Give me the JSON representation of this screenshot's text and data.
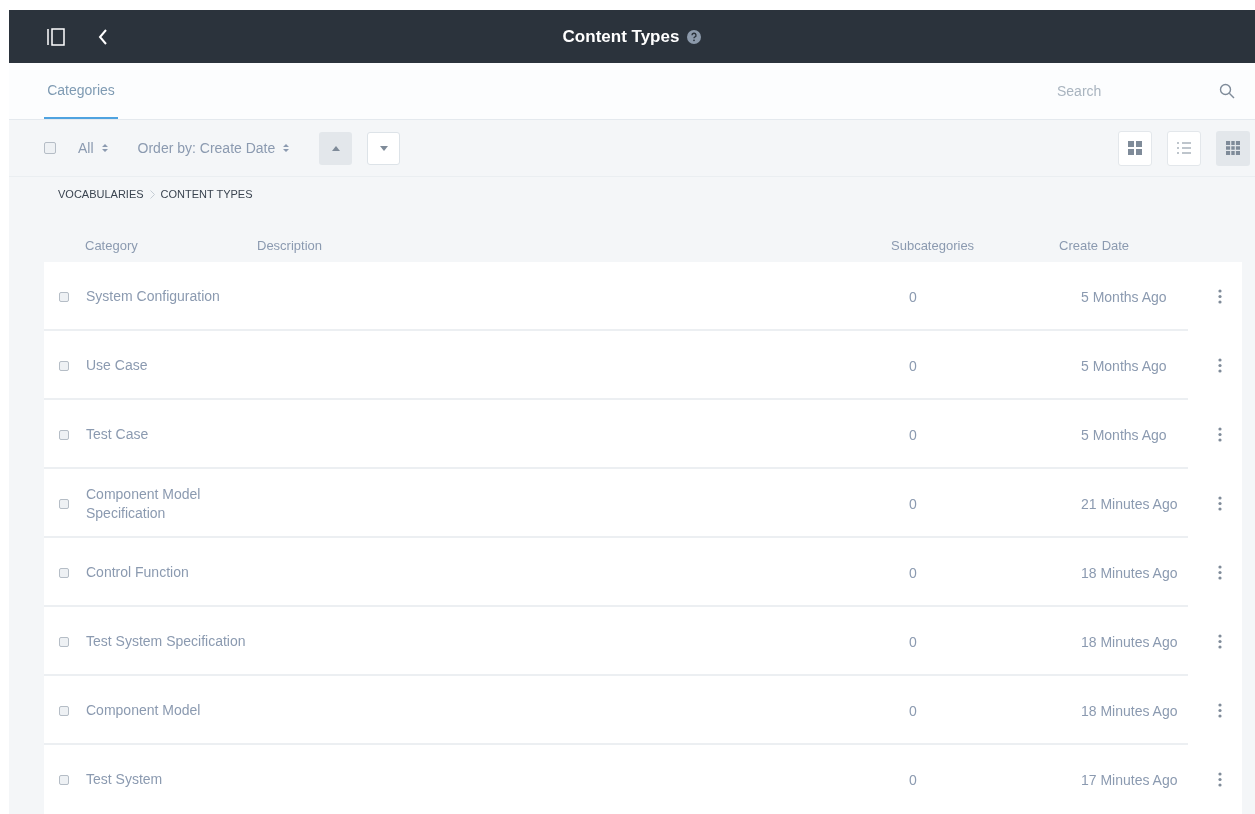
{
  "header": {
    "title": "Content Types"
  },
  "tabs": [
    {
      "label": "Categories",
      "selected": true
    }
  ],
  "search": {
    "placeholder": "Search"
  },
  "toolbar": {
    "select_all": {
      "label": "All",
      "checked": false
    },
    "order_by": "Order by: Create Date",
    "sort": [
      {
        "kind": "up",
        "selected": true
      },
      {
        "kind": "down",
        "selected": false
      }
    ],
    "views": [
      {
        "kind": "cards",
        "selected": false
      },
      {
        "kind": "list",
        "selected": false
      },
      {
        "kind": "table",
        "selected": true
      }
    ]
  },
  "breadcrumb": [
    "VOCABULARIES",
    "CONTENT TYPES"
  ],
  "table": {
    "columns": [
      "Category",
      "Description",
      "Subcategories",
      "Create Date"
    ],
    "rows": [
      {
        "category": "System Configuration",
        "subcategories": "0",
        "create_date": "5 Months Ago",
        "checked": false
      },
      {
        "category": "Use Case",
        "subcategories": "0",
        "create_date": "5 Months Ago",
        "checked": false
      },
      {
        "category": "Test Case",
        "subcategories": "0",
        "create_date": "5 Months Ago",
        "checked": false
      },
      {
        "category": "Component Model Specification",
        "subcategories": "0",
        "create_date": "21 Minutes Ago",
        "checked": false
      },
      {
        "category": "Control Function",
        "subcategories": "0",
        "create_date": "18 Minutes Ago",
        "checked": false
      },
      {
        "category": "Test System Specification",
        "subcategories": "0",
        "create_date": "18 Minutes Ago",
        "checked": false
      },
      {
        "category": "Component Model",
        "subcategories": "0",
        "create_date": "18 Minutes Ago",
        "checked": false
      },
      {
        "category": "Test System",
        "subcategories": "0",
        "create_date": "17 Minutes Ago",
        "checked": false
      }
    ]
  }
}
